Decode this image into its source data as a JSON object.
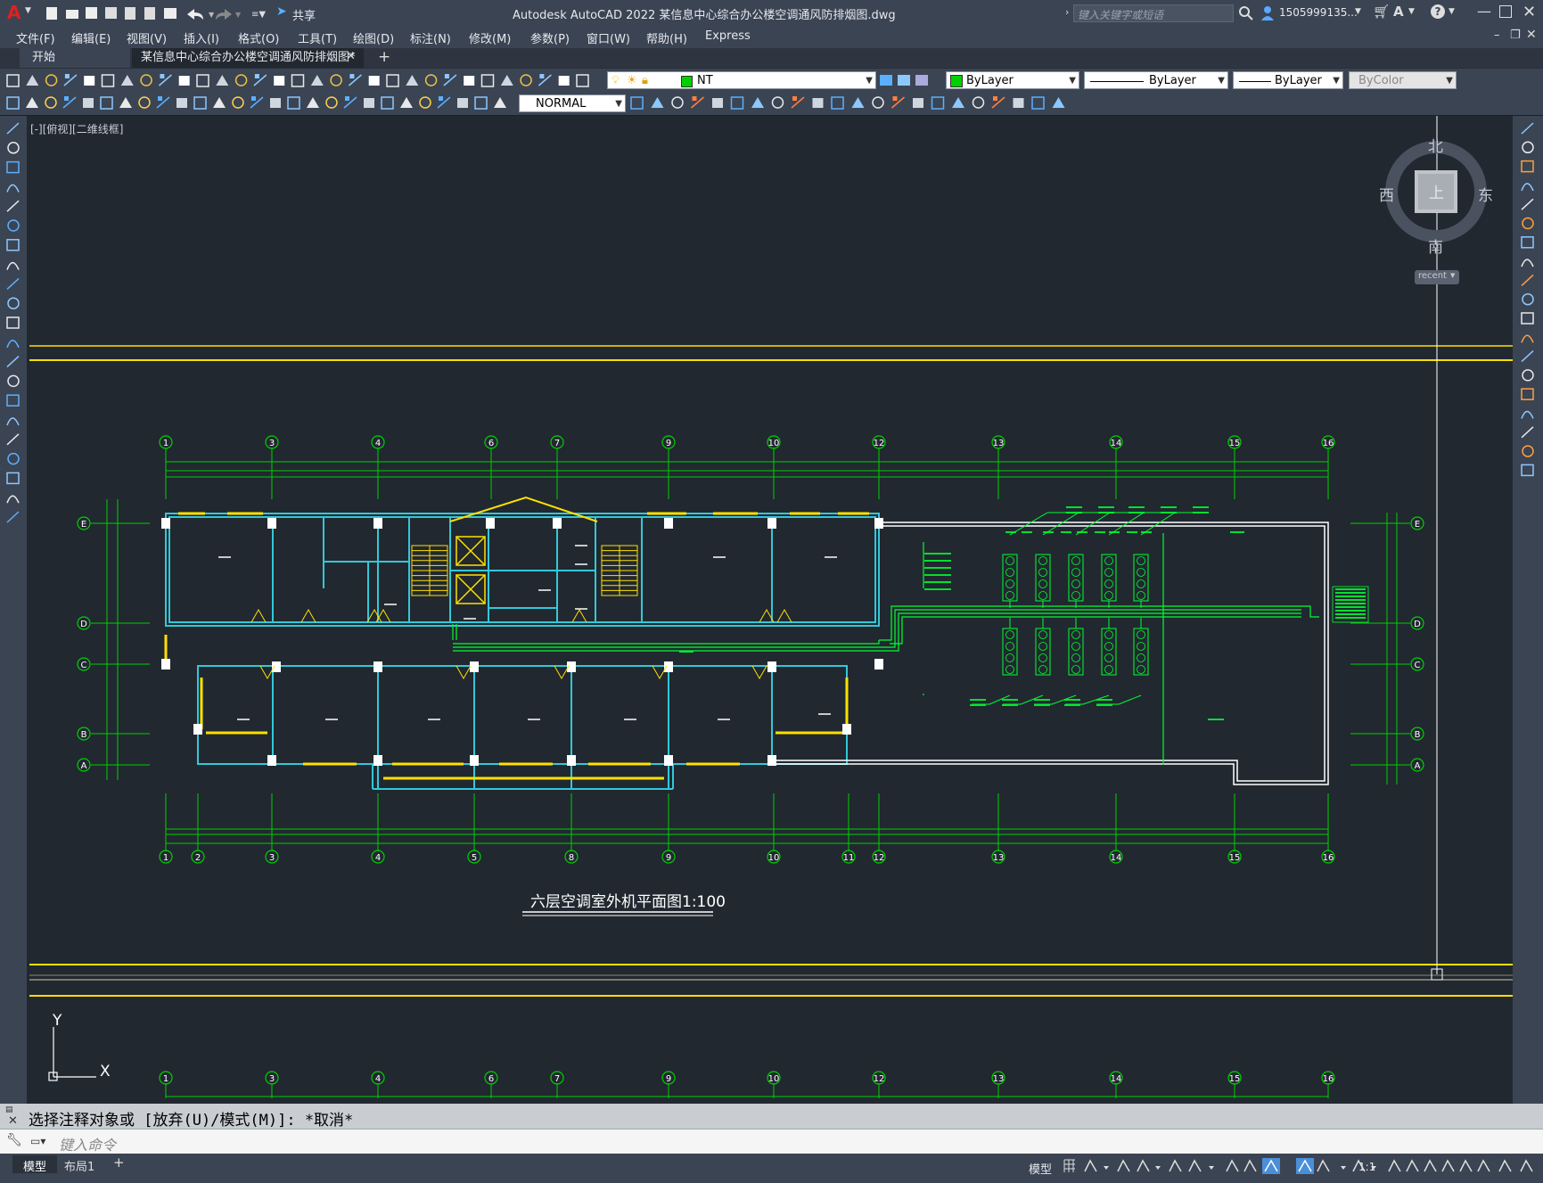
{
  "app": {
    "title": "Autodesk AutoCAD 2022    某信息中心综合办公楼空调通风防排烟图.dwg",
    "share_label": "共享",
    "search_placeholder": "键入关键字或短语",
    "user": "1505999135...",
    "logo": "A"
  },
  "menu": [
    "文件(F)",
    "编辑(E)",
    "视图(V)",
    "插入(I)",
    "格式(O)",
    "工具(T)",
    "绘图(D)",
    "标注(N)",
    "修改(M)",
    "参数(P)",
    "窗口(W)",
    "帮助(H)",
    "Express"
  ],
  "tabs": [
    {
      "label": "开始"
    },
    {
      "label": "某信息中心综合办公楼空调通风防排烟图*"
    }
  ],
  "toolbar": {
    "layer_value": "NT",
    "color_value": "ByLayer",
    "linetype_value": "ByLayer",
    "lineweight_value": "ByLayer",
    "plotstyle_value": "ByColor",
    "textstyle_value": "NORMAL"
  },
  "colors": {
    "background": "#212830",
    "axis_green": "#00d000",
    "wall_cyan": "#33c8d8",
    "window_yellow": "#ffe000",
    "white": "#ffffff"
  },
  "viewport": {
    "label": "[-][俯视][二维线框]",
    "viewcube": {
      "north": "北",
      "south": "南",
      "east": "东",
      "west": "西",
      "top": "上",
      "wcs": "recent"
    }
  },
  "drawing": {
    "title": "六层空调室外机平面图1:100",
    "grid_top": [
      "1",
      "3",
      "4",
      "6",
      "7",
      "9",
      "10",
      "12",
      "13",
      "14",
      "15",
      "16"
    ],
    "grid_bottom": [
      "1",
      "2",
      "3",
      "4",
      "5",
      "8",
      "9",
      "10",
      "11",
      "12",
      "13",
      "14",
      "15",
      "16"
    ],
    "grid_rows": [
      "E",
      "D",
      "C",
      "B",
      "A"
    ],
    "ucs_x": "X",
    "ucs_y": "Y"
  },
  "command": {
    "history": "选择注释对象或 [放弃(U)/模式(M)]: *取消*",
    "placeholder": "键入命令"
  },
  "layout_tabs": [
    "模型",
    "布局1"
  ],
  "status": {
    "model_label": "模型",
    "scale": "1:1"
  }
}
